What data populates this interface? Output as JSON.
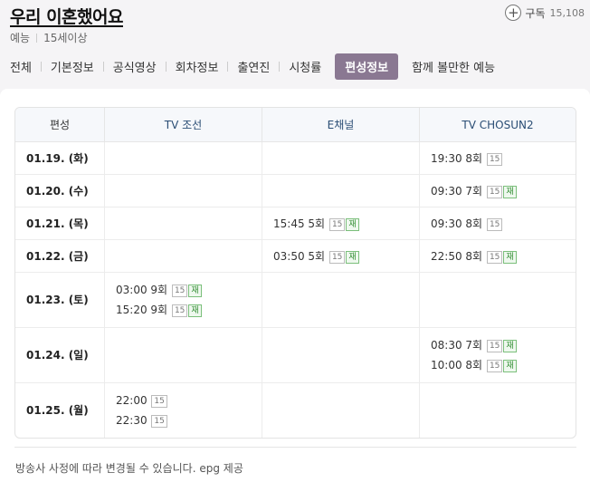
{
  "program": {
    "title": "우리 이혼했어요",
    "genre": "예능",
    "rating": "15세이상",
    "subscribe_label": "구독",
    "subscribe_count": "15,108",
    "subscribe_icon": "plus-icon"
  },
  "tabs": [
    {
      "label": "전체"
    },
    {
      "label": "기본정보"
    },
    {
      "label": "공식영상"
    },
    {
      "label": "회차정보"
    },
    {
      "label": "출연진"
    },
    {
      "label": "시청률"
    },
    {
      "label": "편성정보"
    },
    {
      "label": "함께 볼만한 예능"
    }
  ],
  "active_tab": "편성정보",
  "colors": {
    "active_tab_bg": "#8a7892",
    "channel_header": "#2a4d74",
    "rerun_badge": "#2e8b2e"
  },
  "schedule": {
    "headers": [
      "편성",
      "TV 조선",
      "E채널",
      "TV CHOSUN2"
    ],
    "rows": [
      {
        "date": "01.19. (화)",
        "tvchosun": [],
        "echannel": [],
        "chosun2": [
          {
            "time": "19:30",
            "ep": "8회",
            "rating": "15",
            "rerun": ""
          }
        ]
      },
      {
        "date": "01.20. (수)",
        "tvchosun": [],
        "echannel": [],
        "chosun2": [
          {
            "time": "09:30",
            "ep": "7회",
            "rating": "15",
            "rerun": "재"
          }
        ]
      },
      {
        "date": "01.21. (목)",
        "tvchosun": [],
        "echannel": [
          {
            "time": "15:45",
            "ep": "5회",
            "rating": "15",
            "rerun": "재"
          }
        ],
        "chosun2": [
          {
            "time": "09:30",
            "ep": "8회",
            "rating": "15",
            "rerun": ""
          }
        ]
      },
      {
        "date": "01.22. (금)",
        "tvchosun": [],
        "echannel": [
          {
            "time": "03:50",
            "ep": "5회",
            "rating": "15",
            "rerun": "재"
          }
        ],
        "chosun2": [
          {
            "time": "22:50",
            "ep": "8회",
            "rating": "15",
            "rerun": "재"
          }
        ]
      },
      {
        "date": "01.23. (토)",
        "tvchosun": [
          {
            "time": "03:00",
            "ep": "9회",
            "rating": "15",
            "rerun": "재"
          },
          {
            "time": "15:20",
            "ep": "9회",
            "rating": "15",
            "rerun": "재"
          }
        ],
        "echannel": [],
        "chosun2": []
      },
      {
        "date": "01.24. (일)",
        "tvchosun": [],
        "echannel": [],
        "chosun2": [
          {
            "time": "08:30",
            "ep": "7회",
            "rating": "15",
            "rerun": "재"
          },
          {
            "time": "10:00",
            "ep": "8회",
            "rating": "15",
            "rerun": "재"
          }
        ]
      },
      {
        "date": "01.25. (월)",
        "tvchosun": [
          {
            "time": "22:00",
            "ep": "",
            "rating": "15",
            "rerun": ""
          },
          {
            "time": "22:30",
            "ep": "",
            "rating": "15",
            "rerun": ""
          }
        ],
        "echannel": [],
        "chosun2": []
      }
    ]
  },
  "footer": {
    "notice": "방송사 사정에 따라 변경될 수 있습니다. epg 제공"
  }
}
